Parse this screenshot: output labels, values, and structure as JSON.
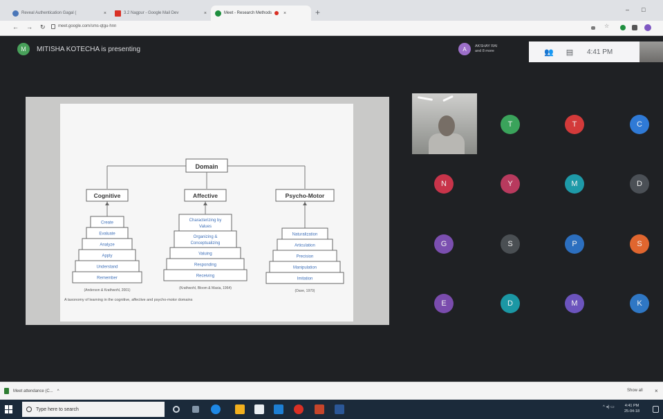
{
  "browser": {
    "tabs": [
      {
        "title": "Reveal Authentication Gagal (",
        "favicon_color": "#4a76b8"
      },
      {
        "title": "3.2 Nagpur - Google Mail Dev",
        "favicon_color": "#d93025"
      },
      {
        "title": "Meet - Research Methods",
        "favicon_color": "#1e8e3e"
      }
    ],
    "new_tab_symbol": "+",
    "url": "meet.google.com/sms-qtgu-hnn",
    "window_controls": [
      "–",
      "□",
      "×"
    ]
  },
  "meet": {
    "presenter": {
      "initial": "M",
      "text": "MITISHA KOTECHA is presenting"
    },
    "presentation_chip": {
      "initial": "A",
      "line1": "AKSHAY RAI",
      "line2": "and 8 more"
    },
    "time": "4:41 PM",
    "participants": [
      {
        "initial": "T",
        "color": "#3aa35b"
      },
      {
        "initial": "T",
        "color": "#d33a3a"
      },
      {
        "initial": "C",
        "color": "#2f7ad6"
      },
      {
        "initial": "N",
        "color": "#c8344a"
      },
      {
        "initial": "Y",
        "color": "#b83a5e"
      },
      {
        "initial": "M",
        "color": "#1e9aa8"
      },
      {
        "initial": "D",
        "color": "#4b5056"
      },
      {
        "initial": "G",
        "color": "#7b4fb0"
      },
      {
        "initial": "S",
        "color": "#4a4f53"
      },
      {
        "initial": "P",
        "color": "#2c6fbf"
      },
      {
        "initial": "S",
        "color": "#e0662f"
      },
      {
        "initial": "E",
        "color": "#7a4cad"
      },
      {
        "initial": "D",
        "color": "#1b97a4"
      },
      {
        "initial": "M",
        "color": "#6c54bd"
      },
      {
        "initial": "K",
        "color": "#2f77c4"
      }
    ]
  },
  "slide": {
    "domain_label": "Domain",
    "columns": [
      {
        "title": "Cognitive",
        "levels": [
          "Create",
          "Evaluate",
          "Analyze",
          "Apply",
          "Understand",
          "Remember"
        ],
        "citation": "(Anderson & Krathwohl, 2001)"
      },
      {
        "title": "Affective",
        "levels": [
          "Characterizing by Values",
          "Organizing & Conceptualizing",
          "Valuing",
          "Responding",
          "Receiving"
        ],
        "citation": "(Krathwohl, Bloom & Masia, 1964)"
      },
      {
        "title": "Psycho-Motor",
        "levels": [
          "Naturalization",
          "Articulation",
          "Precision",
          "Manipulation",
          "Imitation"
        ],
        "citation": "(Dave, 1970)"
      }
    ],
    "caption": "A taxonomy of learning in the cognitive, affective and psycho-motor domains"
  },
  "downloads": {
    "item": "Meet attendance (C...",
    "show_all": "Show all",
    "close": "×"
  },
  "taskbar": {
    "search_placeholder": "Type here to search",
    "clock_time": "4:41 PM",
    "clock_date": "25-04-18",
    "apps": [
      "task-view",
      "edge",
      "file-explorer",
      "store",
      "mail",
      "chrome",
      "powerpoint",
      "word"
    ]
  }
}
